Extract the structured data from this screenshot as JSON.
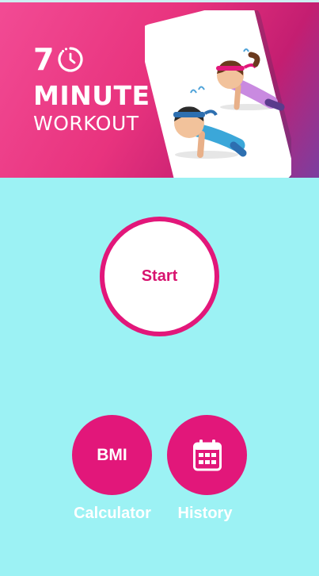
{
  "banner": {
    "title_number": "7",
    "title_line2": "MINUTE",
    "title_line3": "WORKOUT"
  },
  "start_button": {
    "label": "Start"
  },
  "bmi_button": {
    "label": "BMI",
    "caption": "Calculator"
  },
  "history_button": {
    "icon": "calendar-icon",
    "caption": "History"
  },
  "colors": {
    "background": "#9CF2F4",
    "accent": "#E2177A",
    "banner_pink": "#E8337E",
    "banner_purple": "#7B3FA0"
  }
}
